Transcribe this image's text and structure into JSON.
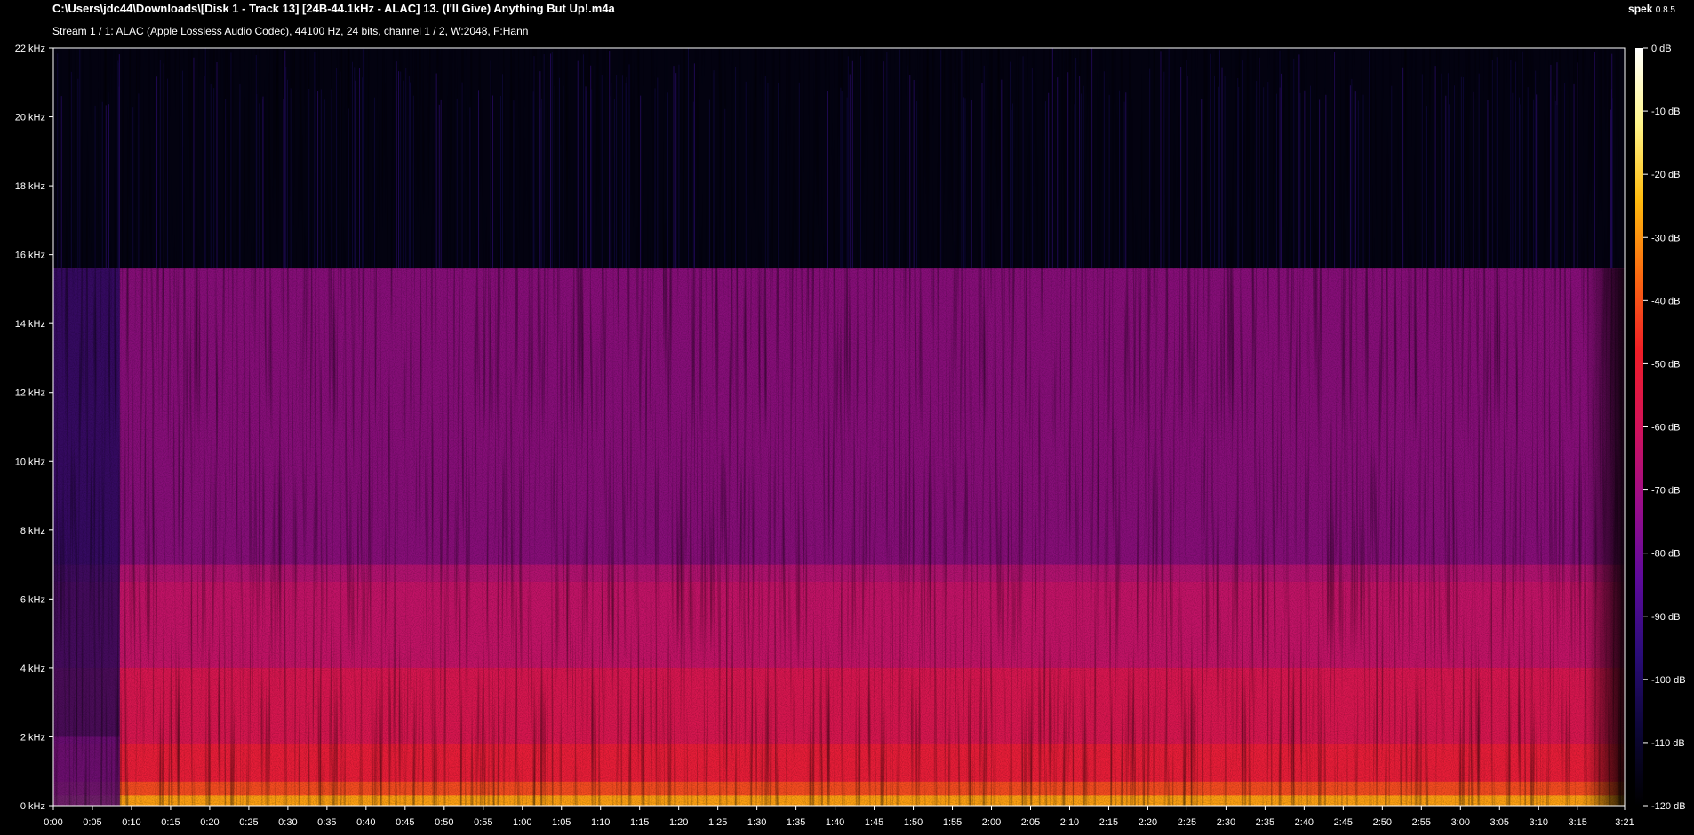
{
  "header": {
    "file_path": "C:\\Users\\jdc44\\Downloads\\[Disk 1 - Track 13] [24B-44.1kHz - ALAC] 13. (I'll Give) Anything But Up!.m4a",
    "stream_info": "Stream 1 / 1: ALAC (Apple Lossless Audio Codec), 44100 Hz, 24 bits, channel 1 / 2, W:2048, F:Hann"
  },
  "app": {
    "name": "spek",
    "version": "0.8.5"
  },
  "colors": {
    "background": "#000000",
    "axis": "#ffffff",
    "palette": [
      "#000000",
      "#0c0636",
      "#2a0c79",
      "#5e0a9c",
      "#9b0d8a",
      "#d2125a",
      "#f01e27",
      "#fb6a10",
      "#ffbb0e",
      "#fff58a",
      "#ffffff"
    ]
  },
  "chart_data": {
    "type": "heatmap",
    "title": "",
    "xlabel": "",
    "ylabel": "",
    "x_range_seconds": [
      0,
      201
    ],
    "y_range_khz": [
      0,
      22
    ],
    "x_ticks": [
      "0:00",
      "0:05",
      "0:10",
      "0:15",
      "0:20",
      "0:25",
      "0:30",
      "0:35",
      "0:40",
      "0:45",
      "0:50",
      "0:55",
      "1:00",
      "1:05",
      "1:10",
      "1:15",
      "1:20",
      "1:25",
      "1:30",
      "1:35",
      "1:40",
      "1:45",
      "1:50",
      "1:55",
      "2:00",
      "2:05",
      "2:10",
      "2:15",
      "2:20",
      "2:25",
      "2:30",
      "2:35",
      "2:40",
      "2:45",
      "2:50",
      "2:55",
      "3:00",
      "3:05",
      "3:10",
      "3:15",
      "3:21"
    ],
    "y_ticks": [
      "0 kHz",
      "2 kHz",
      "4 kHz",
      "6 kHz",
      "8 kHz",
      "10 kHz",
      "12 kHz",
      "14 kHz",
      "16 kHz",
      "18 kHz",
      "20 kHz",
      "22 kHz"
    ],
    "colorbar_range_db": [
      -120,
      0
    ],
    "colorbar_ticks": [
      "0 dB",
      "-10 dB",
      "-20 dB",
      "-30 dB",
      "-40 dB",
      "-50 dB",
      "-60 dB",
      "-70 dB",
      "-80 dB",
      "-90 dB",
      "-100 dB",
      "-110 dB",
      "-120 dB"
    ],
    "lowpass_cutoff_khz": 15.6,
    "intro_end_seconds": 8.5,
    "fade_out_start_seconds": 196
  }
}
